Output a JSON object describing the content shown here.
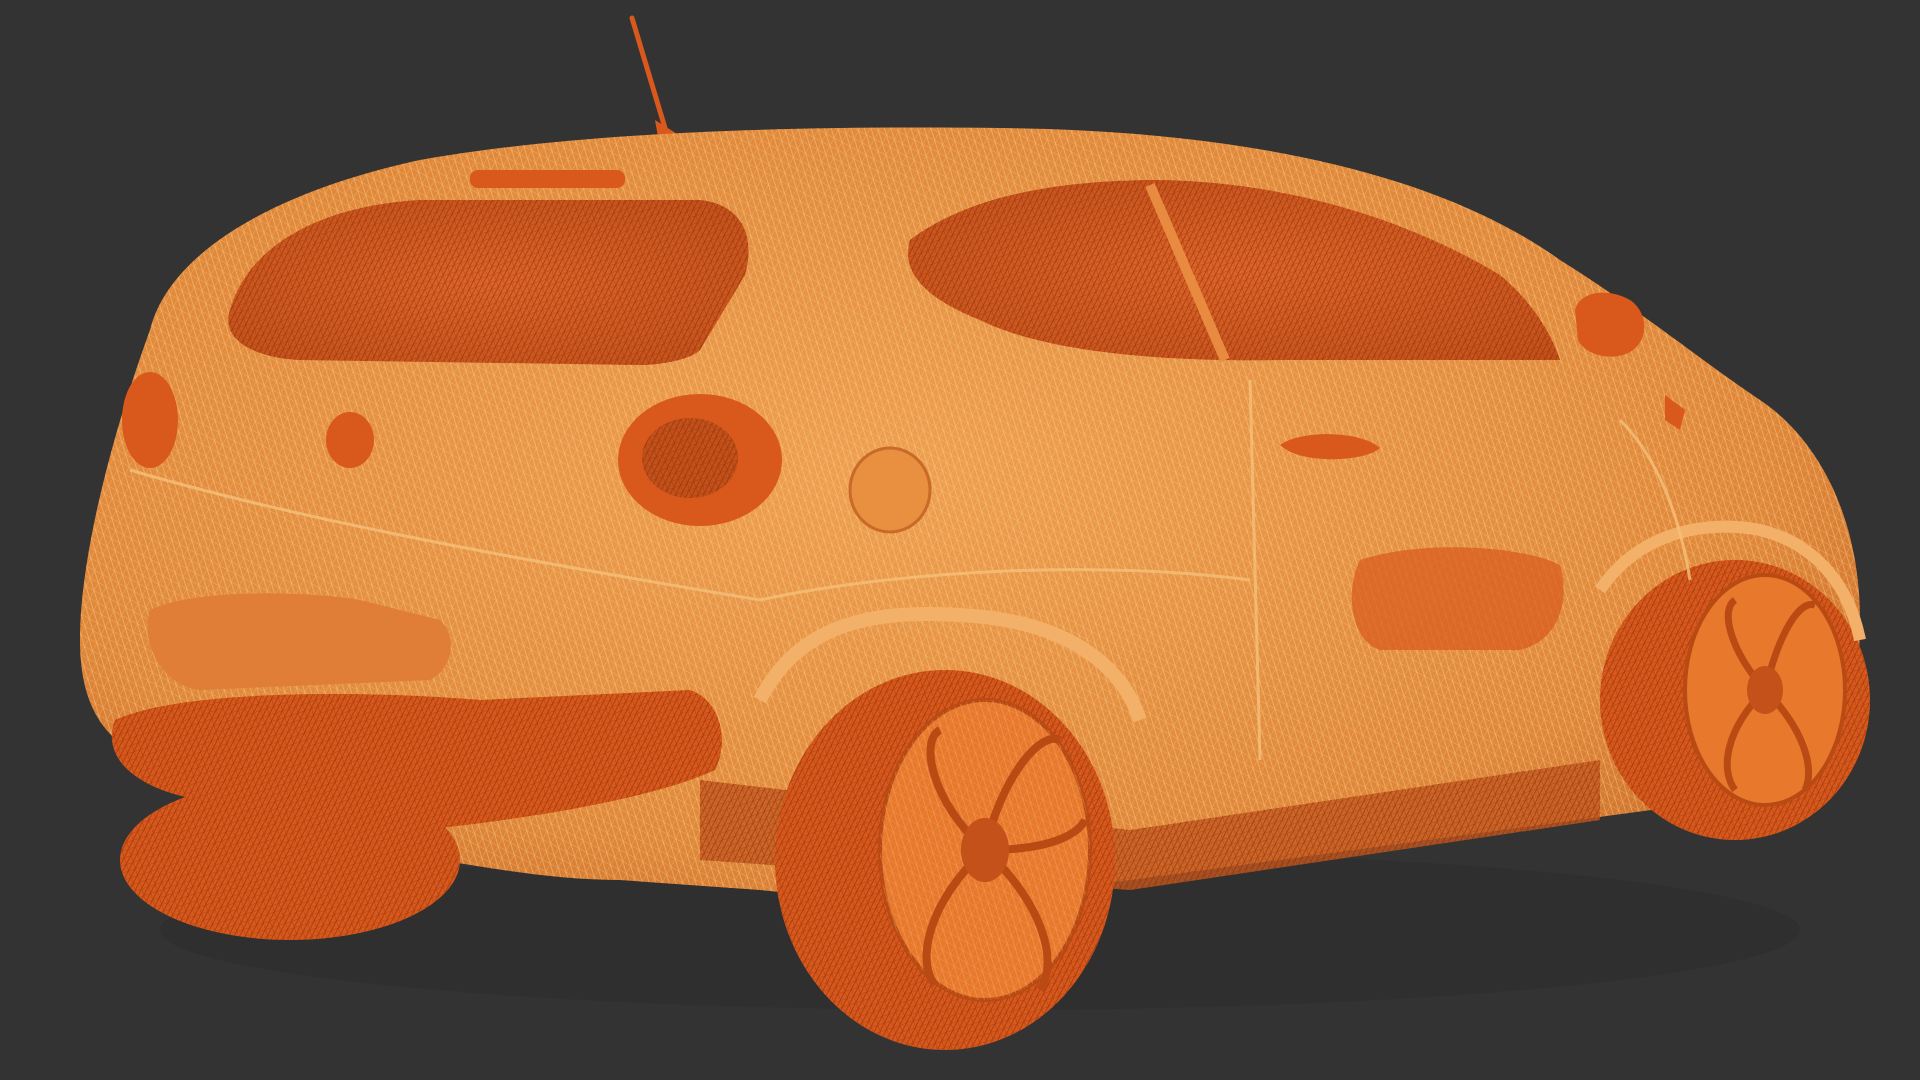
{
  "scene": {
    "background_color": "#333333",
    "subject": "car-wireframe-render",
    "colors": {
      "body_fill": "#e68a3c",
      "body_light": "#f0a85a",
      "body_dark": "#c85a20",
      "wire_light": "#ffd28a",
      "wire_dark": "#8a3a10",
      "glass": "#d9581c",
      "tire": "#d9581c",
      "rim": "#e8782c"
    }
  }
}
